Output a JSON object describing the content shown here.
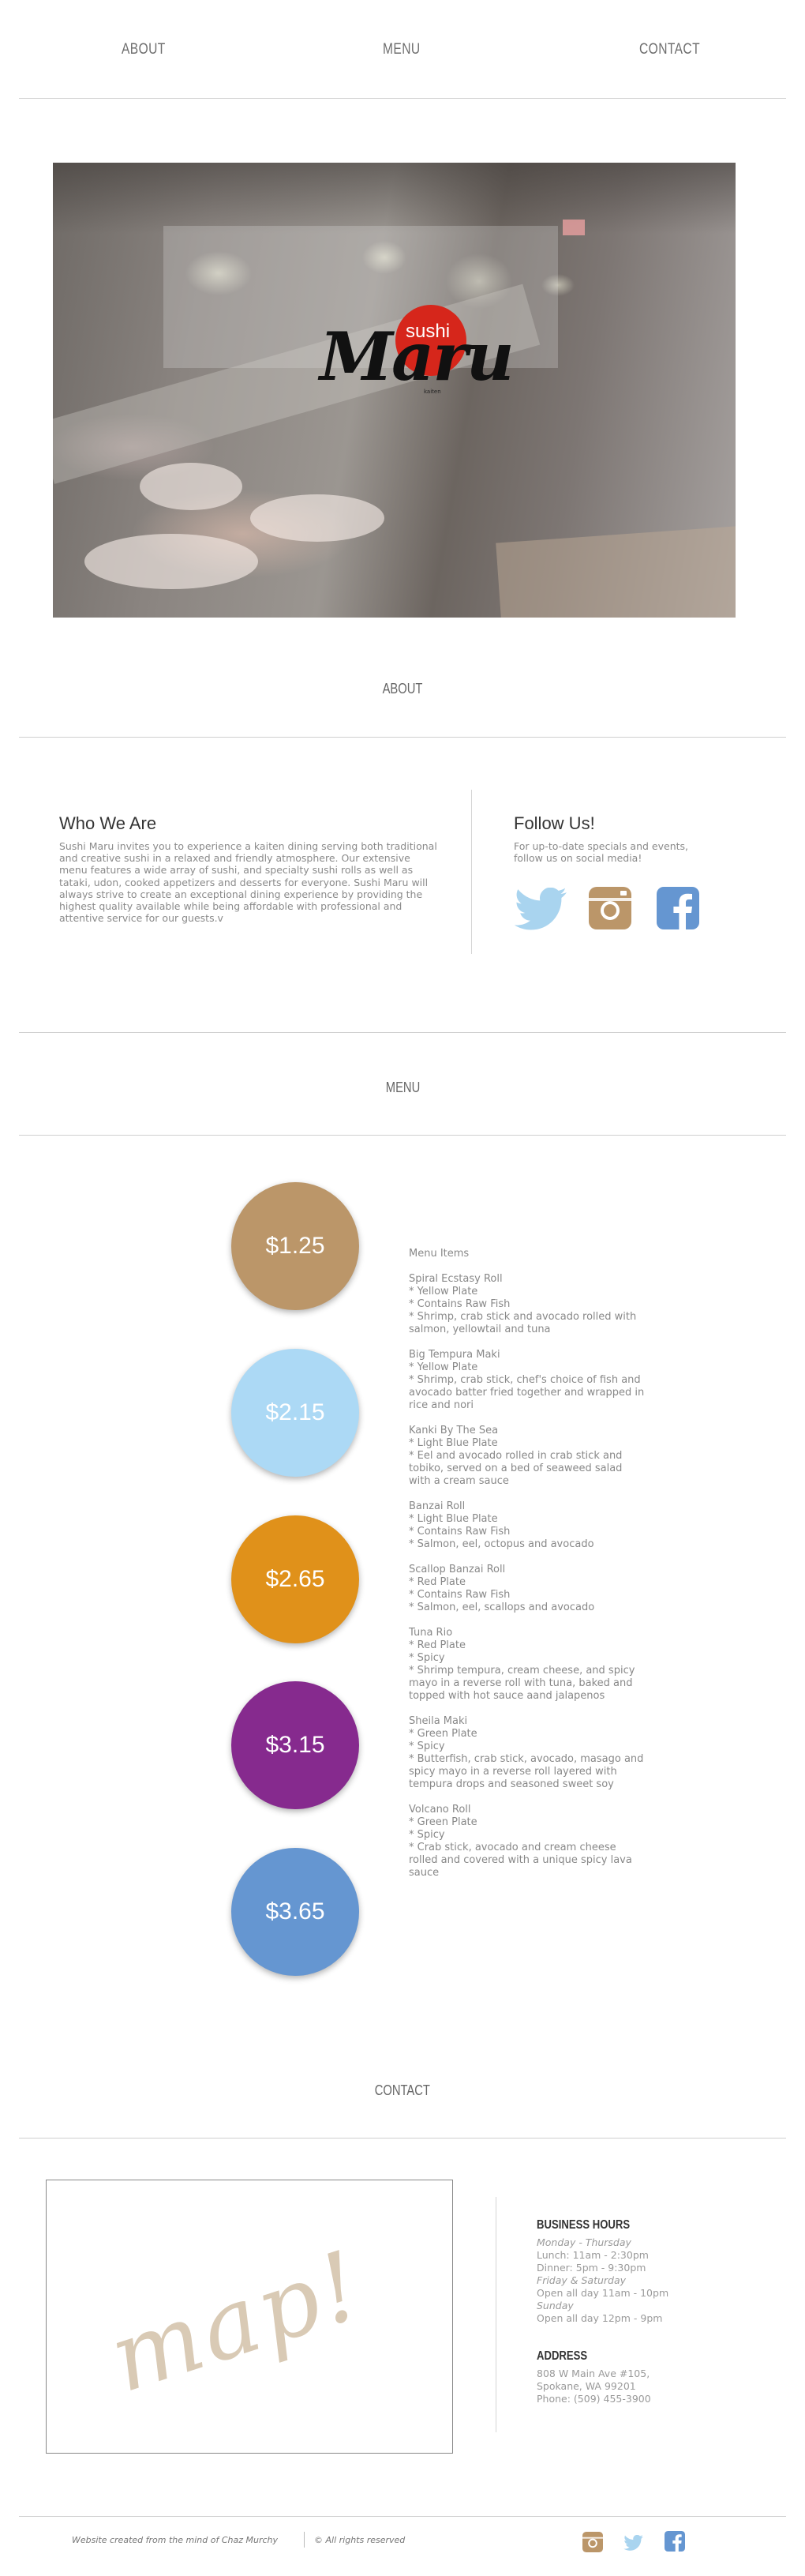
{
  "nav": {
    "about": "ABOUT",
    "menu": "MENU",
    "contact": "CONTACT"
  },
  "hero": {
    "logo_sushi": "sushi",
    "logo_maru": "Maru",
    "logo_sub": "kaiten"
  },
  "about": {
    "title": "ABOUT",
    "who_heading": "Who We Are",
    "who_text": "Sushi Maru invites you to experience a kaiten dining serving both traditional and creative sushi in a relaxed and friendly atmosphere. Our extensive menu features a wide array of sushi, and specialty sushi rolls as well as tataki, udon, cooked appetizers and desserts for everyone. Sushi Maru will always strive to create an exceptional dining experience by providing the highest quality available while being affordable with professional and attentive service for our guests.v",
    "follow_heading": "Follow Us!",
    "follow_text": "For up-to-date specials and events, follow us on social media!",
    "social": [
      "twitter-icon",
      "instagram-icon",
      "facebook-icon"
    ]
  },
  "menu": {
    "title": "MENU",
    "prices": [
      {
        "label": "$1.25",
        "color": "#bb9669"
      },
      {
        "label": "$2.15",
        "color": "#acd9f5"
      },
      {
        "label": "$2.65",
        "color": "#e0911a"
      },
      {
        "label": "$3.15",
        "color": "#862a8e"
      },
      {
        "label": "$3.65",
        "color": "#6596d1"
      }
    ],
    "list_heading": "Menu Items",
    "items": [
      {
        "name": "Spiral Ecstasy Roll",
        "details": "* Yellow Plate\n* Contains Raw Fish\n* Shrimp, crab stick and avocado rolled with salmon, yellowtail and tuna"
      },
      {
        "name": "Big Tempura Maki",
        "details": "* Yellow Plate\n* Shrimp, crab stick, chef's choice of fish and avocado batter fried together and wrapped in rice and nori"
      },
      {
        "name": "Kanki By The Sea",
        "details": "* Light Blue Plate\n* Eel and avocado rolled in crab stick and tobiko, served on a bed of seaweed salad with a cream sauce"
      },
      {
        "name": "Banzai Roll",
        "details": "* Light Blue Plate\n* Contains Raw Fish\n* Salmon, eel, octopus and avocado"
      },
      {
        "name": "Scallop Banzai Roll",
        "details": "* Red Plate\n* Contains Raw Fish\n* Salmon, eel, scallops and avocado"
      },
      {
        "name": "Tuna Rio",
        "details": "* Red Plate\n* Spicy\n* Shrimp tempura, cream cheese, and spicy mayo in a reverse roll with tuna, baked and topped with hot sauce aand jalapenos"
      },
      {
        "name": "Sheila Maki",
        "details": "* Green Plate\n* Spicy\n* Butterfish, crab stick, avocado, masago and spicy mayo in a reverse roll layered with tempura drops and seasoned sweet soy"
      },
      {
        "name": "Volcano Roll",
        "details": "* Green Plate\n* Spicy\n* Crab stick, avocado and cream cheese rolled and covered with a unique spicy lava sauce"
      }
    ]
  },
  "contact": {
    "title": "CONTACT",
    "map_label": "map!",
    "hours_heading": "BUSINESS HOURS",
    "hours": [
      {
        "text": "Monday - Thursday",
        "italic": true
      },
      {
        "text": "Lunch: 11am - 2:30pm",
        "italic": false
      },
      {
        "text": "Dinner: 5pm - 9:30pm",
        "italic": false
      },
      {
        "text": "Friday & Saturday",
        "italic": true
      },
      {
        "text": "Open all day 11am - 10pm",
        "italic": false
      },
      {
        "text": "Sunday",
        "italic": true
      },
      {
        "text": "Open all day 12pm - 9pm",
        "italic": false
      }
    ],
    "address_heading": "ADDRESS",
    "address_lines": [
      "808 W Main Ave #105,",
      "Spokane, WA 99201",
      "Phone: (509) 455-3900"
    ]
  },
  "footer": {
    "credit": "Website created from the mind of Chaz Murchy",
    "rights": "© All rights reserved"
  },
  "colors": {
    "twitter": "#a9d4ef",
    "instagram": "#bb9669",
    "facebook": "#6596d1",
    "logo_red": "#d6261b"
  }
}
